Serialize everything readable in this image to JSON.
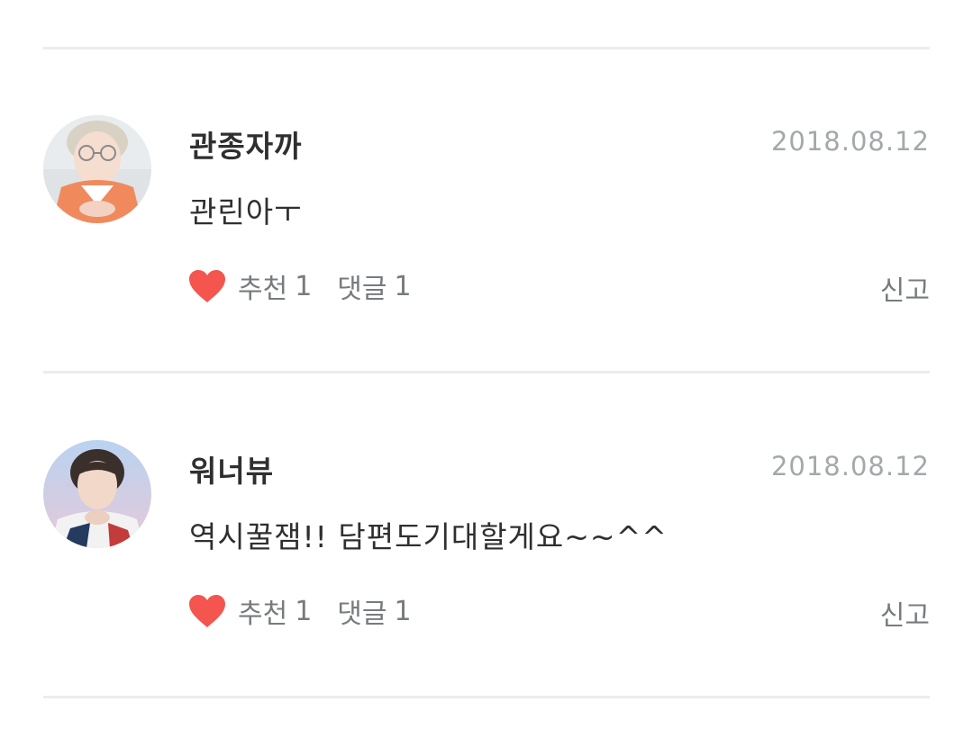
{
  "comments": [
    {
      "username": "관종자까",
      "date": "2018.08.12",
      "text": "관린아ㅜ",
      "avatar_icon": "profile-photo-glasses-person",
      "like_label": "추천",
      "like_count": "1",
      "reply_label": "댓글",
      "reply_count": "1",
      "report_label": "신고"
    },
    {
      "username": "워너뷰",
      "date": "2018.08.12",
      "text": "역시꿀잼!! 담편도기대할게요~~^^",
      "avatar_icon": "profile-photo-person",
      "like_label": "추천",
      "like_count": "1",
      "reply_label": "댓글",
      "reply_count": "1",
      "report_label": "신고"
    }
  ],
  "colors": {
    "heart": "#f4554f",
    "divider": "#ebeced",
    "date": "#a3a8ab",
    "meta": "#777b7e"
  }
}
